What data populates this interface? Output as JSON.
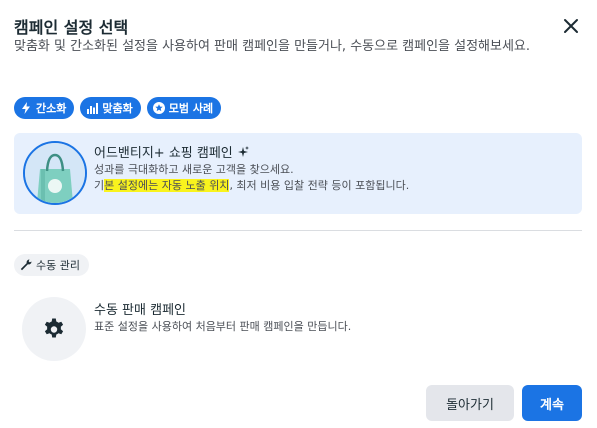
{
  "dialog": {
    "title": "캠페인 설정 선택",
    "subtitle": "맞춤화 및 간소화된 설정을 사용하여 판매 캠페인을 만들거나, 수동으로 캠페인을 설정해보세요.",
    "close_icon": "close-icon"
  },
  "badges": [
    {
      "label": "간소화",
      "icon": "lightning-icon"
    },
    {
      "label": "맞춤화",
      "icon": "bar-chart-icon"
    },
    {
      "label": "모범 사례",
      "icon": "star-icon"
    }
  ],
  "advantage_card": {
    "title": "어드밴티지+ 쇼핑 캠페인",
    "sparkle_icon": "sparkle-icon",
    "description_line1": "성과를 극대화하고 새로운 고객을 찾으세요.",
    "description_pre": "기",
    "description_highlight": "본 설정에는 자동 노출 위치",
    "description_post": ", 최저 비용 입찰 전략 등이 포함됩니다.",
    "icon": "shopping-bag-icon"
  },
  "manual_tag": {
    "label": "수동 관리",
    "icon": "wrench-icon"
  },
  "manual_card": {
    "title": "수동 판매 캠페인",
    "description": "표준 설정을 사용하여 처음부터 판매 캠페인을 만듭니다.",
    "icon": "gear-icon"
  },
  "buttons": {
    "back_label": "돌아가기",
    "next_label": "계속"
  },
  "colors": {
    "accent": "#1b74e4",
    "card_bg": "#e7f0fd",
    "highlight": "#f9f31d"
  }
}
